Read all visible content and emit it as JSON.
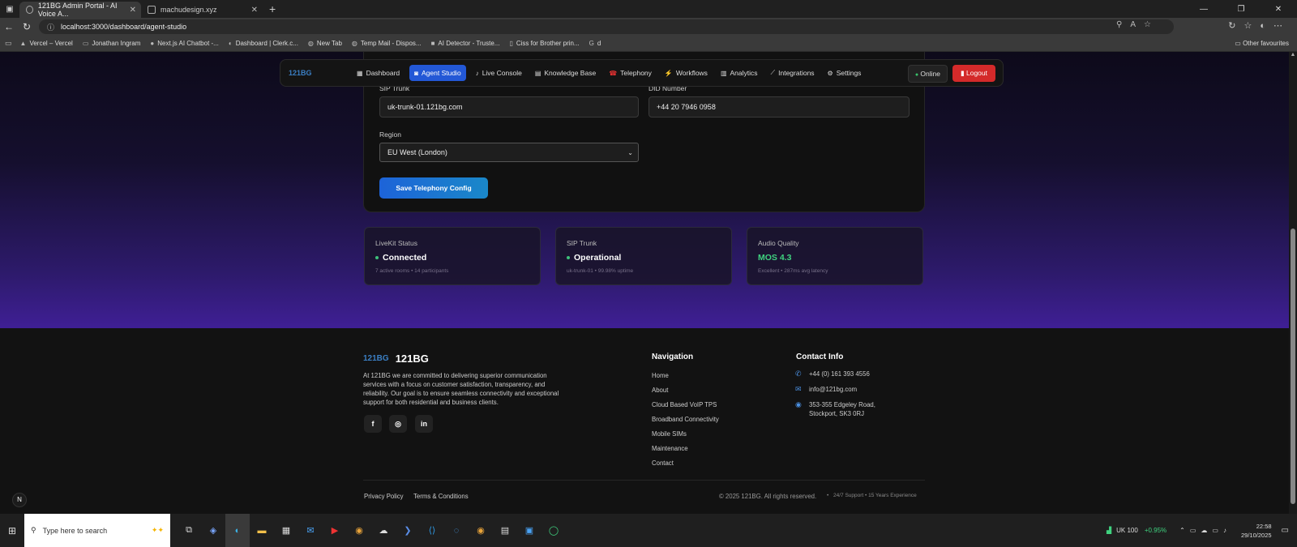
{
  "browser": {
    "tabs": [
      {
        "title": "121BG Admin Portal - AI Voice A..."
      },
      {
        "title": "machudesign.xyz"
      }
    ],
    "url": "localhost:3000/dashboard/agent-studio",
    "bookmarks": [
      "Vercel – Vercel",
      "Jonathan Ingram",
      "Next.js AI Chatbot -...",
      "Dashboard | Clerk.c...",
      "New Tab",
      "Temp Mail - Dispos...",
      "AI Detector - Truste...",
      "Ciss for Brother prin...",
      "d"
    ],
    "other_favourites": "Other favourites"
  },
  "nav": {
    "logo": "121BG",
    "items": [
      "Dashboard",
      "Agent Studio",
      "Live Console",
      "Knowledge Base",
      "Telephony",
      "Workflows",
      "Analytics",
      "Integrations",
      "Settings"
    ],
    "active": "Agent Studio",
    "status": "Online",
    "logout": "Logout"
  },
  "telephony": {
    "sip_trunk_label": "SIP Trunk",
    "sip_trunk_value": "uk-trunk-01.121bg.com",
    "did_label": "DID Number",
    "did_value": "+44 20 7946 0958",
    "region_label": "Region",
    "region_value": "EU West (London)",
    "save_label": "Save Telephony Config"
  },
  "stats": [
    {
      "label": "LiveKit Status",
      "value": "Connected",
      "sub": "7 active rooms • 14 participants"
    },
    {
      "label": "SIP Trunk",
      "value": "Operational",
      "sub": "uk-trunk-01 • 99.98% uptime"
    },
    {
      "label": "Audio Quality",
      "value": "MOS 4.3",
      "sub": "Excellent • 287ms avg latency"
    }
  ],
  "footer": {
    "brand": "121BG",
    "description": "At 121BG we are committed to delivering superior communication services with a focus on customer satisfaction, transparency, and reliability. Our goal is to ensure seamless connectivity and exceptional support for both residential and business clients.",
    "nav_heading": "Navigation",
    "nav_links": [
      "Home",
      "About",
      "Cloud Based VoIP TPS",
      "Broadband Connectivity",
      "Mobile SIMs",
      "Maintenance",
      "Contact"
    ],
    "contact_heading": "Contact Info",
    "phone": "+44 (0) 161 393 4556",
    "email": "info@121bg.com",
    "address_line1": "353-355 Edgeley Road,",
    "address_line2": "Stockport, SK3 0RJ",
    "privacy": "Privacy Policy",
    "terms": "Terms & Conditions",
    "copyright": "© 2025 121BG. All rights reserved.",
    "tagline": "24/7 Support • 15 Years Experience"
  },
  "taskbar": {
    "search_placeholder": "Type here to search",
    "ticker_name": "UK 100",
    "ticker_change": "+0.95%",
    "time": "22:58",
    "date": "29/10/2025"
  }
}
